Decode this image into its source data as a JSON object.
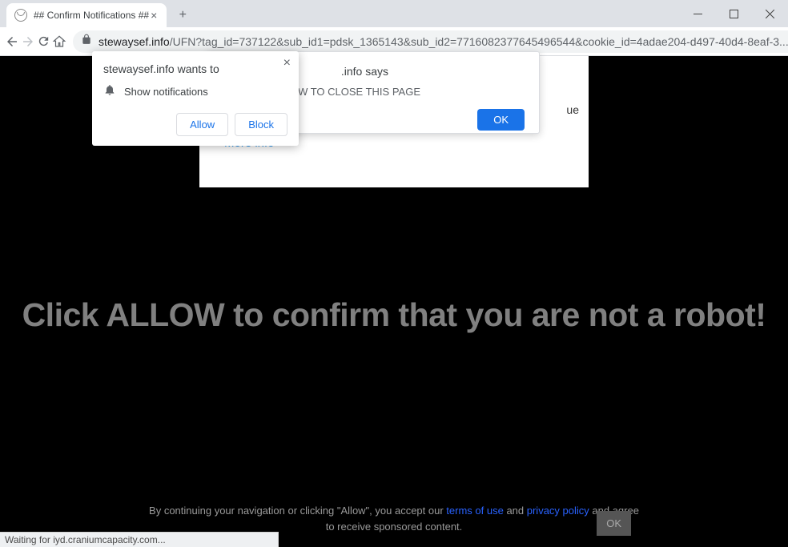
{
  "window": {
    "tab_title": "## Confirm Notifications ##",
    "url_domain": "stewaysef.info",
    "url_path": "/UFN?tag_id=737122&sub_id1=pdsk_1365143&sub_id2=7716082377645496544&cookie_id=4adae204-d497-40d4-8eaf-3..."
  },
  "permission_prompt": {
    "title": "stewaysef.info wants to",
    "item": "Show notifications",
    "allow": "Allow",
    "block": "Block"
  },
  "alert": {
    "title_suffix": ".info says",
    "body_suffix": "OW TO CLOSE THIS PAGE",
    "ok": "OK"
  },
  "card": {
    "more_info": "More info",
    "partial": "ue"
  },
  "page": {
    "headline": "Click ALLOW to confirm that you are not a robot!"
  },
  "consent": {
    "prefix": "By continuing your navigation or clicking \"Allow\", you accept our ",
    "terms": "terms of use",
    "and": " and ",
    "privacy": "privacy policy",
    "suffix": " and agree",
    "line2": "to receive sponsored content.",
    "ok": "OK"
  },
  "status": "Waiting for iyd.craniumcapacity.com..."
}
